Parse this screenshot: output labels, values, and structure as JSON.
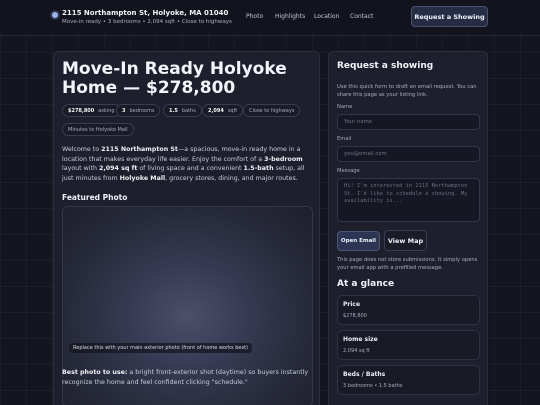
{
  "header": {
    "title": "2115 Northampton St, Holyoke, MA 01040",
    "subtitle": "Move-in ready • 3 bedrooms • 2,094 sqft • Close to highways",
    "nav": [
      "Photo",
      "Highlights",
      "Location",
      "Contact"
    ],
    "cta": "Request a Showing"
  },
  "main": {
    "title": "Move-In Ready Holyoke Home — $278,800",
    "pills": [
      {
        "strong": "$278,800",
        "muted": "asking"
      },
      {
        "strong": "3",
        "muted": "bedrooms"
      },
      {
        "strong": "1.5",
        "muted": "baths"
      },
      {
        "strong": "2,094",
        "muted": "sqft"
      },
      {
        "strong": "",
        "muted": "Close to highways"
      },
      {
        "strong": "",
        "muted": "Minutes to Holyoke Mall"
      }
    ],
    "intro": {
      "p1": "Welcome to ",
      "addr": "2115 Northampton St",
      "p2": "—a spacious, move-in ready home in a location that makes everyday life easier. Enjoy the comfort of a ",
      "beds": "3-bedroom",
      "p3": " layout with ",
      "sqft": "2,094 sq ft",
      "p4": " of living space and a convenient ",
      "baths": "1.5-bath",
      "p5": " setup, all just minutes from ",
      "mall": "Holyoke Mall",
      "p6": ", grocery stores, dining, and major routes."
    },
    "featured_heading": "Featured Photo",
    "photo_caption": "Replace this with your main exterior photo (front of home works best)",
    "tip": {
      "lead": "Best photo to use:",
      "rest": " a bright front-exterior shot (daytime) so buyers instantly recognize the home and feel confident clicking \"schedule.\""
    }
  },
  "side": {
    "heading": "Request a showing",
    "note": "Use this quick form to draft an email request. You can share this page as your listing link.",
    "name_label": "Name",
    "name_placeholder": "Your name",
    "email_label": "Email",
    "email_placeholder": "you@email.com",
    "message_label": "Message",
    "message_placeholder": "Hi! I'm interested in 2115 Northampton St. I'd like to schedule a showing. My availability is...",
    "open_email": "Open Email",
    "view_map": "View Map",
    "disclaimer": "This page does not store submissions. It simply opens your email app with a prefilled message.",
    "glance_heading": "At a glance",
    "stats": [
      {
        "label": "Price",
        "value": "$278,800"
      },
      {
        "label": "Home size",
        "value": "2,094 sq ft"
      },
      {
        "label": "Beds / Baths",
        "value": "3 bedrooms • 1.5 baths"
      }
    ]
  }
}
